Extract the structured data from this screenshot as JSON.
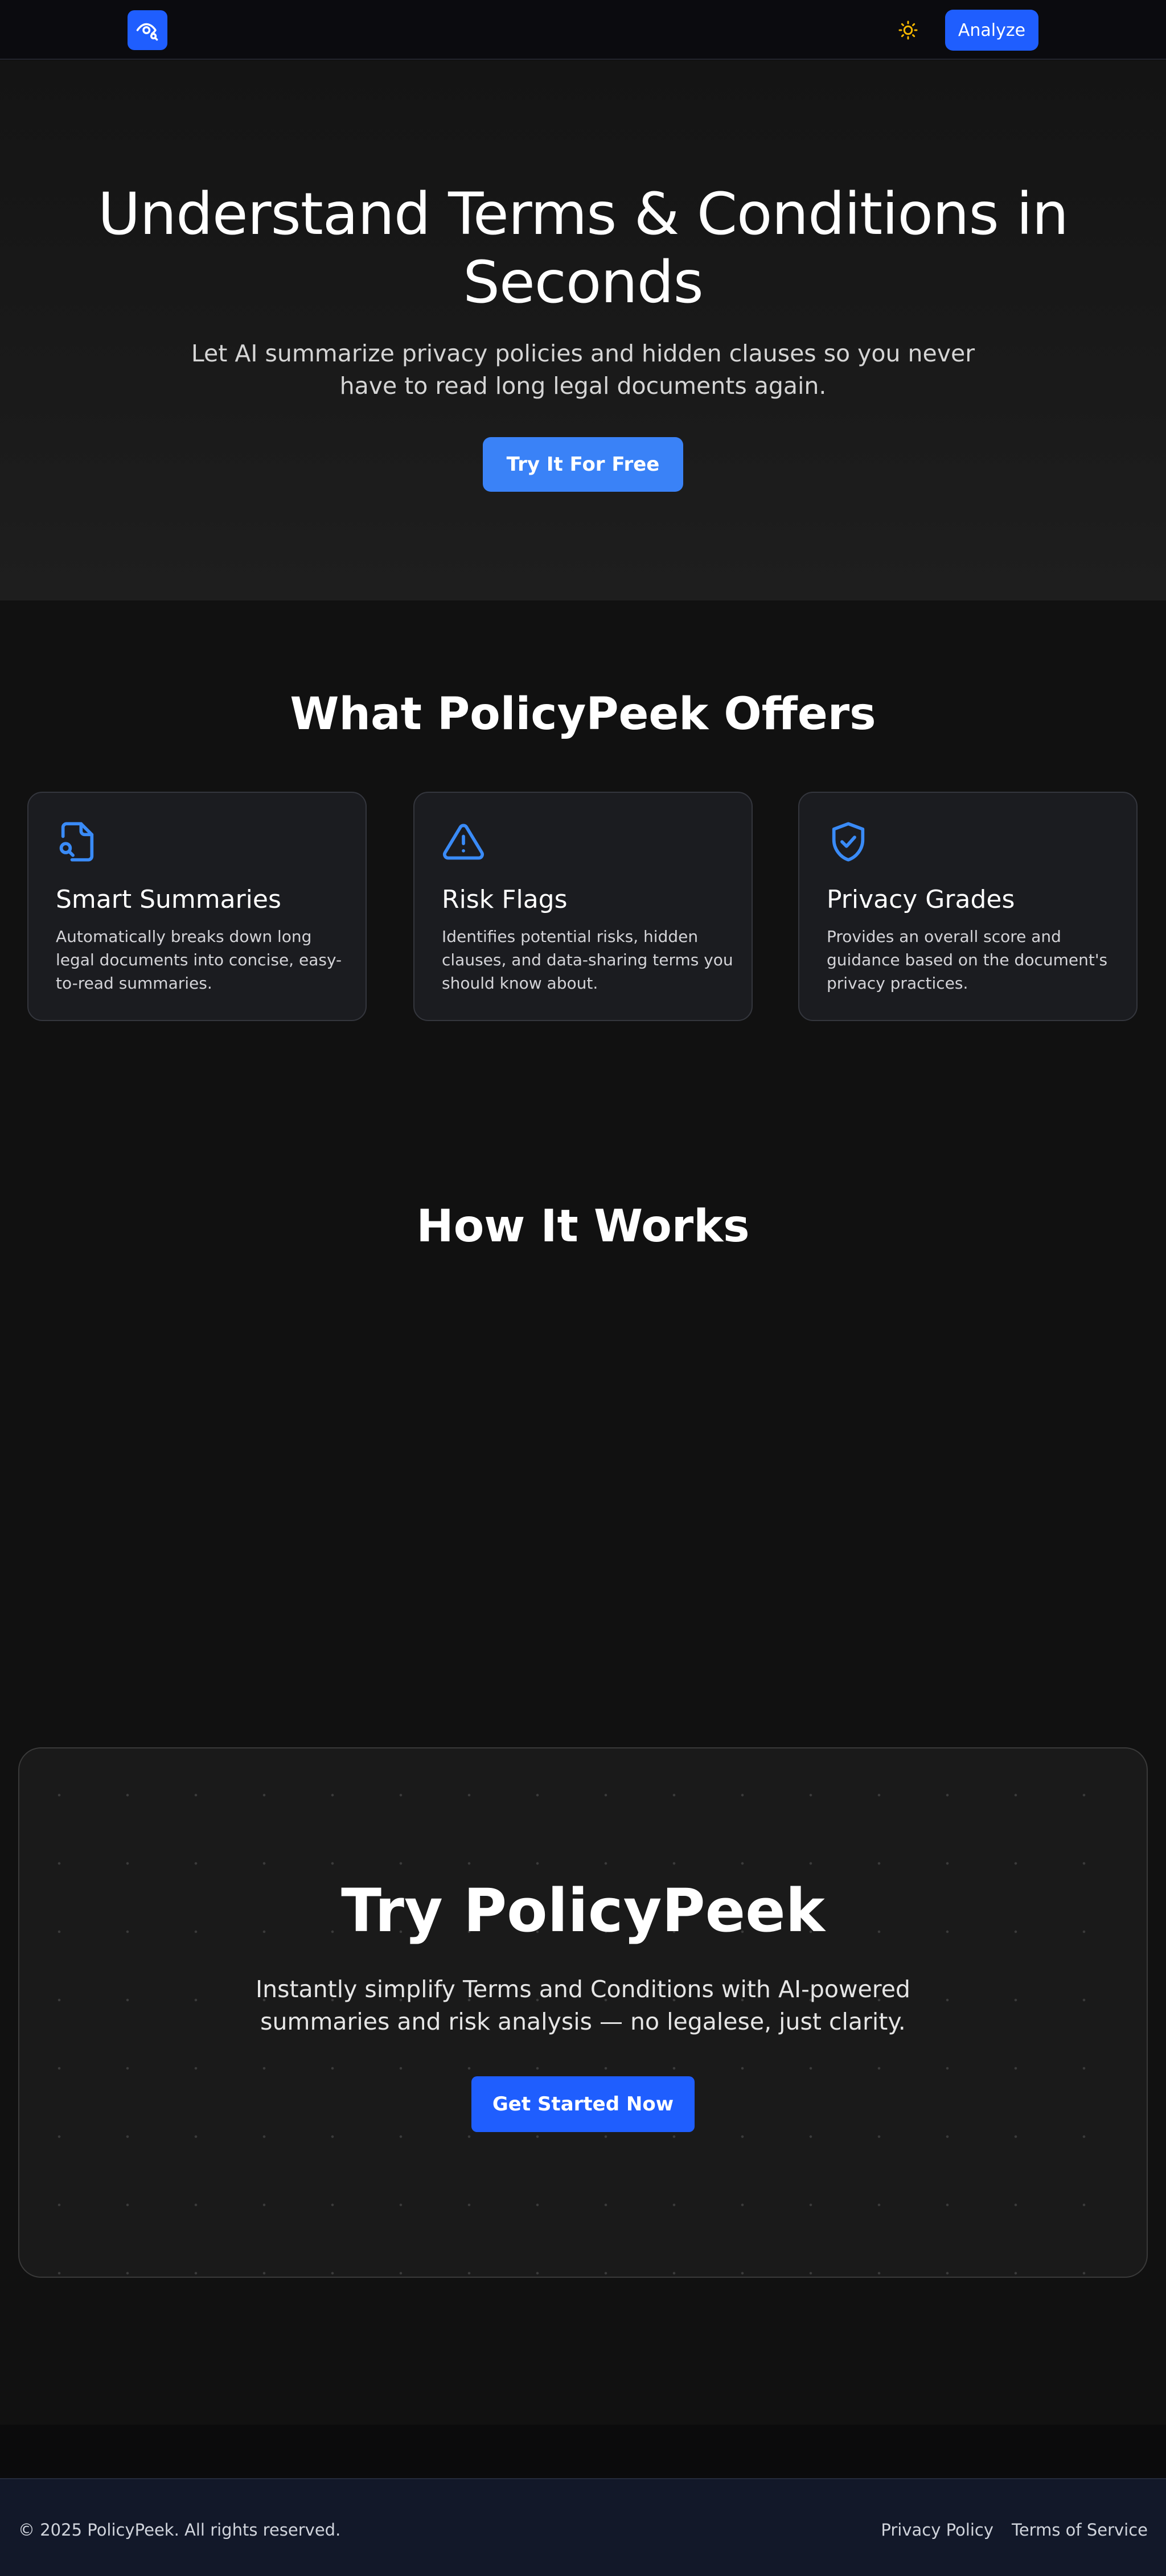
{
  "nav": {
    "logo_icon": "eye-search-icon",
    "theme_icon": "sun-icon",
    "analyze_label": "Analyze"
  },
  "hero": {
    "title": "Understand Terms & Conditions in Seconds",
    "subtitle": "Let AI summarize privacy policies and hidden clauses so you never have to read long legal documents again.",
    "cta_label": "Try It For Free"
  },
  "offers": {
    "title": "What PolicyPeek Offers",
    "cards": [
      {
        "icon": "document-search-icon",
        "title": "Smart Summaries",
        "text": "Automatically breaks down long legal documents into concise, easy-to-read summaries."
      },
      {
        "icon": "warning-triangle-icon",
        "title": "Risk Flags",
        "text": "Identifies potential risks, hidden clauses, and data-sharing terms you should know about."
      },
      {
        "icon": "shield-check-icon",
        "title": "Privacy Grades",
        "text": "Provides an overall score and guidance based on the document's privacy practices."
      }
    ]
  },
  "how": {
    "title": "How It Works"
  },
  "cta": {
    "title": "Try PolicyPeek",
    "subtitle": "Instantly simplify Terms and Conditions with AI-powered summaries and risk analysis — no legalese, just clarity.",
    "button_label": "Get Started Now"
  },
  "footer": {
    "copyright": "© 2025 PolicyPeek. All rights reserved.",
    "links": [
      "Privacy Policy",
      "Terms of Service"
    ]
  },
  "colors": {
    "accent": "#1f5efe",
    "hero_button": "#3a82f7",
    "icon_blue": "#3a8bf7",
    "sun": "#f5b700",
    "background": "#111111",
    "footer_bg": "#121829"
  }
}
